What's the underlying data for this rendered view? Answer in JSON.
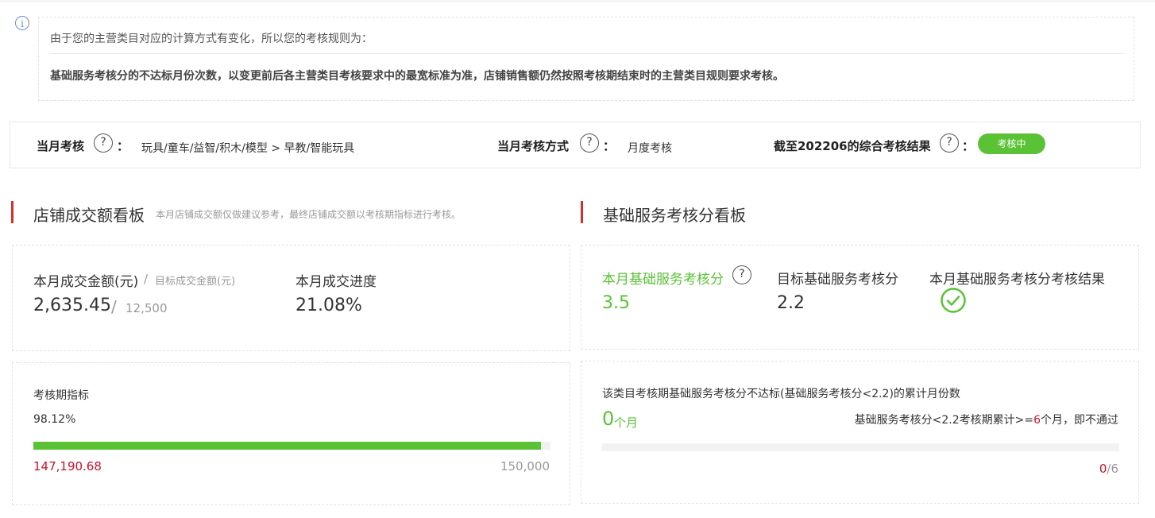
{
  "notice": {
    "line1": "由于您的主营类目对应的计算方式有变化，所以您的考核规则为：",
    "line2": "基础服务考核分的不达标月份次数，以变更前后各主营类目考核要求中的最宽标准为准，店铺销售额仍然按照考核期结束时的主营类目规则要求考核。"
  },
  "status_bar": {
    "current_label": "当月考核",
    "current_value": "玩具/童车/益智/积木/模型 > 早教/智能玩具",
    "method_label": "当月考核方式",
    "method_value": "月度考核",
    "result_label": "截至202206的综合考核结果",
    "result_status": "考核中",
    "qmark": "?",
    "colon": "："
  },
  "left_section": {
    "title": "店铺成交额看板",
    "hint": "本月店铺成交额仅做建议参考，最终店铺成交额以考核期指标进行考核。"
  },
  "right_section": {
    "title": "基础服务考核分看板"
  },
  "gmv_card": {
    "amount_label": "本月成交金额(元)",
    "separator": "/",
    "target_label": "目标成交金额(元)",
    "amount_value": "2,635.45",
    "target_value": "12,500",
    "progress_label": "本月成交进度",
    "progress_value": "21.08%"
  },
  "period_card": {
    "label": "考核期指标",
    "percent": "98.12%",
    "progress_fraction": 0.9812,
    "current_value": "147,190.68",
    "target_value": "150,000"
  },
  "score_card": {
    "current_label": "本月基础服务考核分",
    "current_value": "3.5",
    "target_label": "目标基础服务考核分",
    "target_value": "2.2",
    "result_label": "本月基础服务考核分考核结果",
    "result_icon": "check-circle-icon"
  },
  "fail_card": {
    "title": "该类目考核期基础服务考核分不达标(基础服务考核分<2.2)的累计月份数",
    "count": "0",
    "count_unit": "个月",
    "rule_prefix": "基础服务考核分<2.2考核期累计>=",
    "rule_number": "6",
    "rule_suffix": "个月，即不通过",
    "progress_fraction": 0,
    "progress_current": "0",
    "progress_total": "/6"
  },
  "colors": {
    "green": "#5bc236",
    "red": "#d32f2f",
    "value_red": "#c8102e"
  }
}
